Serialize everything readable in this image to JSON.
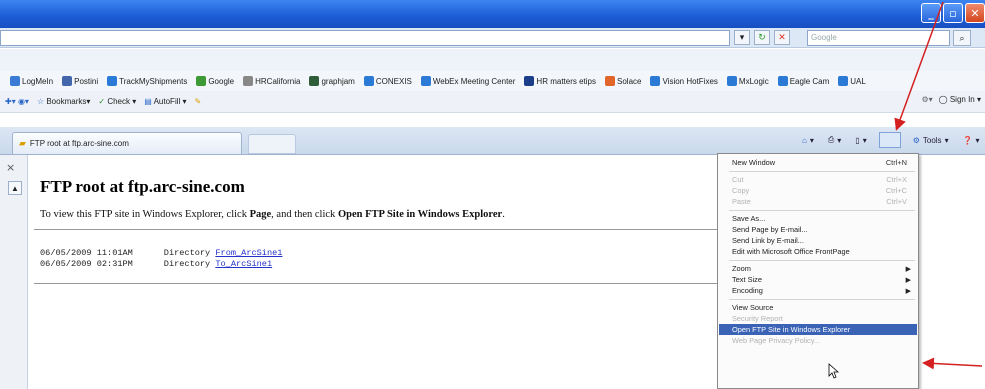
{
  "search": {
    "placeholder": "Google"
  },
  "links": [
    {
      "label": "LogMeIn",
      "icon": "logmein-icon",
      "color": "#3a7bd5"
    },
    {
      "label": "Postini",
      "icon": "page-icon",
      "color": "#4466aa"
    },
    {
      "label": "TrackMyShipments",
      "icon": "ie-page-icon",
      "color": "#2b7bd6"
    },
    {
      "label": "Google",
      "icon": "google-icon",
      "color": "#3d9a34"
    },
    {
      "label": "HRCalifornia",
      "icon": "link-icon",
      "color": "#888888"
    },
    {
      "label": "graphjam",
      "icon": "graphjam-icon",
      "color": "#2f5d3a"
    },
    {
      "label": "CONEXIS",
      "icon": "ie-page-icon",
      "color": "#2b7bd6"
    },
    {
      "label": "WebEx Meeting Center",
      "icon": "ie-page-icon",
      "color": "#2b7bd6"
    },
    {
      "label": "HR matters etips",
      "icon": "hr-icon",
      "color": "#1b3f8a"
    },
    {
      "label": "Solace",
      "icon": "solace-icon",
      "color": "#e0662a"
    },
    {
      "label": "Vision HotFixes",
      "icon": "ie-page-icon",
      "color": "#2b7bd6"
    },
    {
      "label": "MxLogic",
      "icon": "ie-page-icon",
      "color": "#2b7bd6"
    },
    {
      "label": "Eagle Cam",
      "icon": "ie-page-icon",
      "color": "#2b7bd6"
    },
    {
      "label": "UAL",
      "icon": "ie-page-icon",
      "color": "#2b7bd6"
    }
  ],
  "toolbar2": {
    "bookmarks": "Bookmarks",
    "check": "Check",
    "autofill": "AutoFill",
    "signin": "Sign In"
  },
  "tab": {
    "title": "FTP root at ftp.arc-sine.com"
  },
  "cmdbar": {
    "tools": "Tools"
  },
  "page": {
    "title": "FTP root at ftp.arc-sine.com",
    "instr_pre": "To view this FTP site in Windows Explorer, click ",
    "instr_page": "Page",
    "instr_mid": ", and then click ",
    "instr_open": "Open FTP Site in Windows Explorer",
    "instr_end": ".",
    "entries": [
      {
        "date": "06/05/2009 11:01AM",
        "type": "Directory",
        "name": "From_ArcSine1"
      },
      {
        "date": "06/05/2009 02:31PM",
        "type": "Directory",
        "name": "To_ArcSine1"
      }
    ]
  },
  "menu": {
    "items": [
      {
        "label": "New Window",
        "shortcut": "Ctrl+N",
        "disabled": false
      },
      {
        "label": "Cut",
        "shortcut": "Ctrl+X",
        "disabled": true
      },
      {
        "label": "Copy",
        "shortcut": "Ctrl+C",
        "disabled": true
      },
      {
        "label": "Paste",
        "shortcut": "Ctrl+V",
        "disabled": true
      },
      {
        "label": "Save As...",
        "shortcut": "",
        "disabled": false
      },
      {
        "label": "Send Page by E-mail...",
        "shortcut": "",
        "disabled": false
      },
      {
        "label": "Send Link by E-mail...",
        "shortcut": "",
        "disabled": false
      },
      {
        "label": "Edit with Microsoft Office FrontPage",
        "shortcut": "",
        "disabled": false
      },
      {
        "label": "Zoom",
        "shortcut": "",
        "disabled": false
      },
      {
        "label": "Text Size",
        "shortcut": "",
        "disabled": false
      },
      {
        "label": "Encoding",
        "shortcut": "",
        "disabled": false
      },
      {
        "label": "View Source",
        "shortcut": "",
        "disabled": false
      },
      {
        "label": "Security Report",
        "shortcut": "",
        "disabled": true
      },
      {
        "label": "Open FTP Site in Windows Explorer",
        "shortcut": "",
        "disabled": false,
        "highlighted": true
      },
      {
        "label": "Web Page Privacy Policy...",
        "shortcut": "",
        "disabled": true
      }
    ]
  },
  "colors": {
    "annotation_arrow": "#d42020",
    "menu_highlight": "#3a62b5",
    "link": "#2332c8"
  }
}
